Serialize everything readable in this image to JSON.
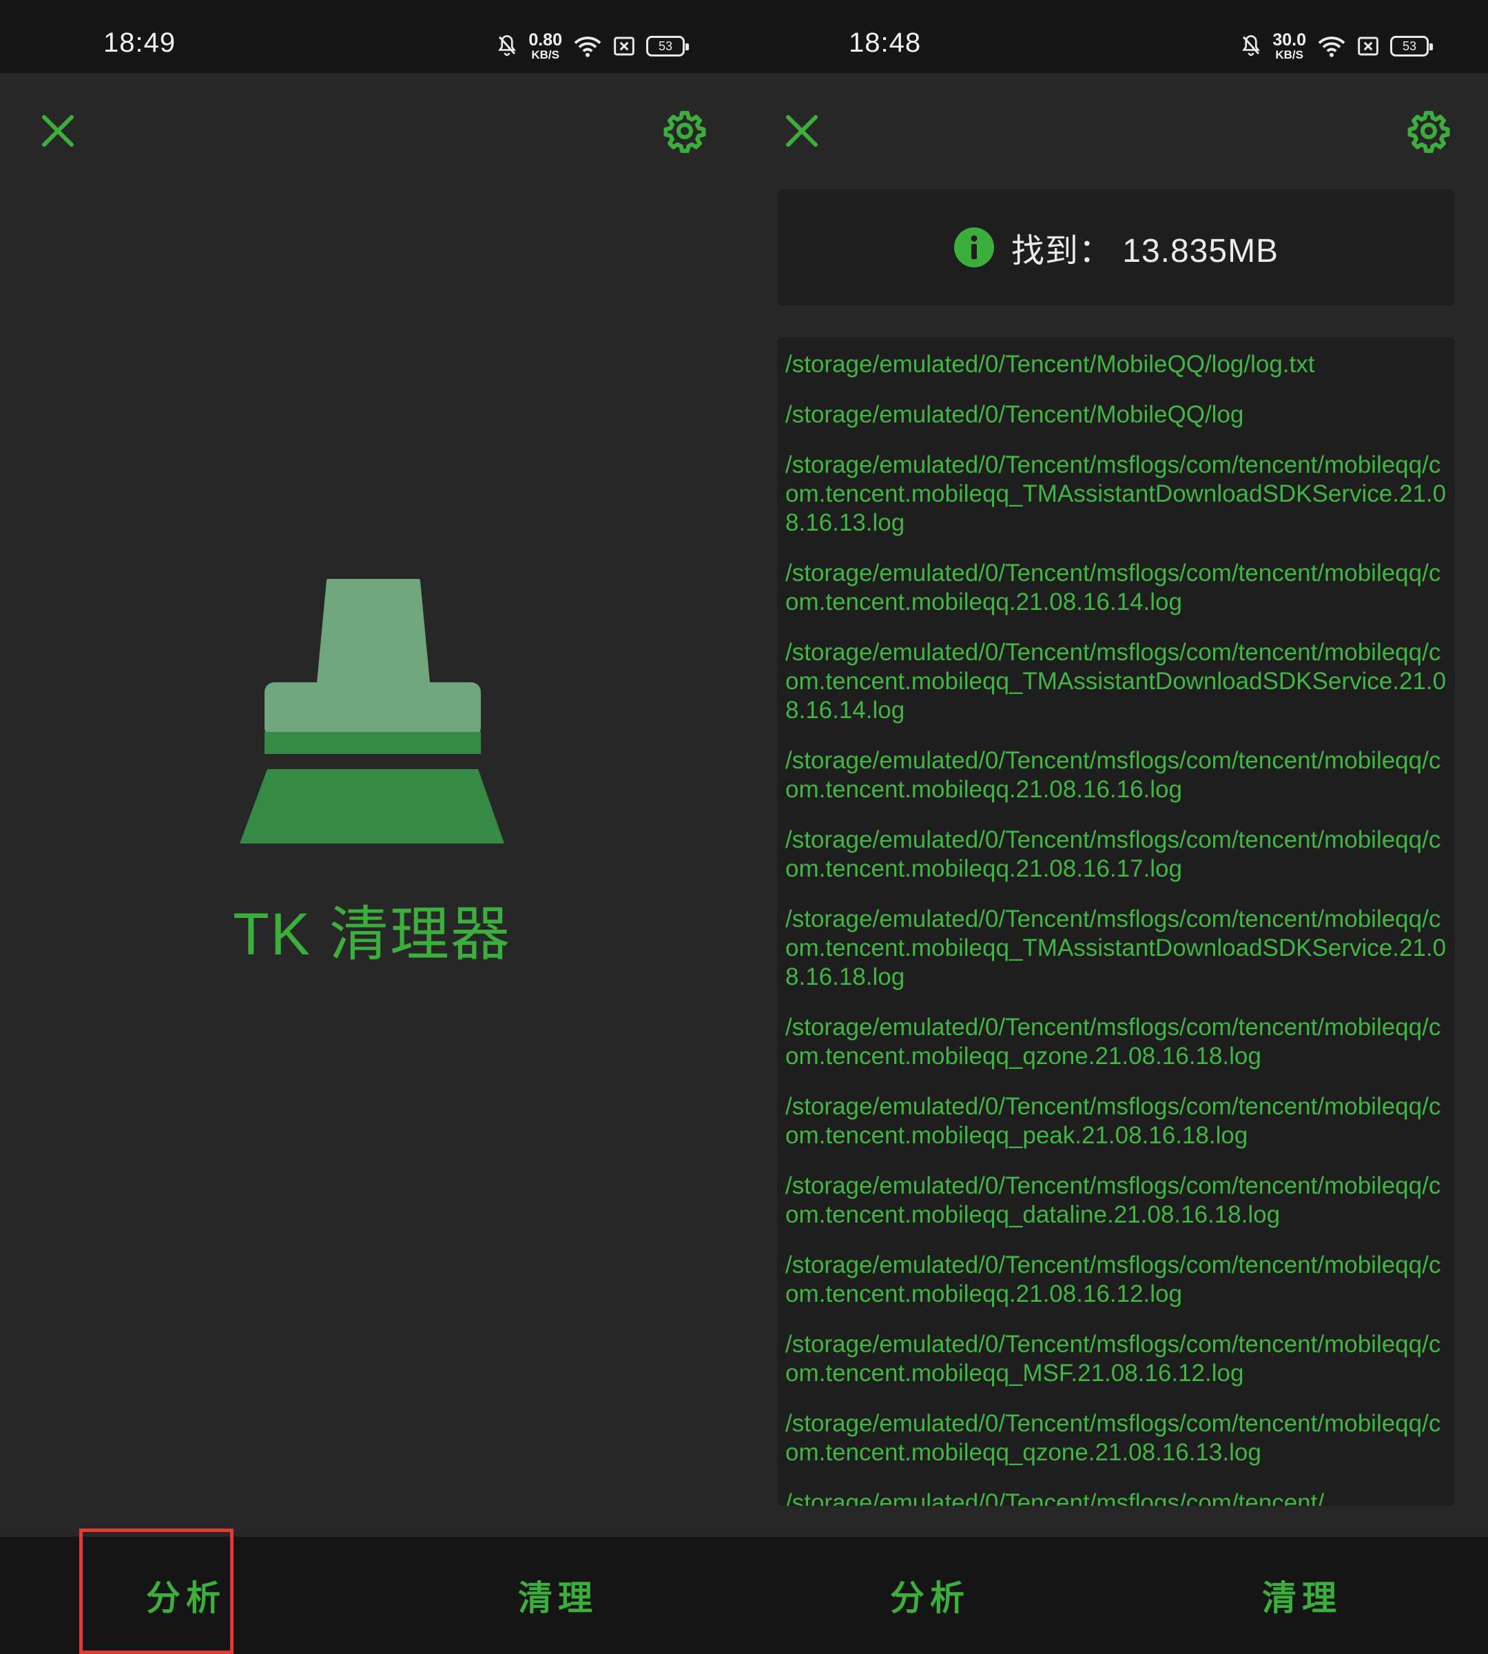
{
  "left": {
    "status": {
      "time": "18:49",
      "speed_value": "0.80",
      "speed_unit": "KB/S",
      "battery": "53"
    },
    "app_title": "TK 清理器",
    "tabs": {
      "analyze": "分析",
      "clean": "清理"
    }
  },
  "right": {
    "status": {
      "time": "18:48",
      "speed_value": "30.0",
      "speed_unit": "KB/S",
      "battery": "53"
    },
    "found_text": "找到： 13.835MB",
    "paths": [
      "/storage/emulated/0/Tencent/MobileQQ/log/log.txt",
      "/storage/emulated/0/Tencent/MobileQQ/log",
      "/storage/emulated/0/Tencent/msflogs/com/tencent/mobileqq/com.tencent.mobileqq_TMAssistantDownloadSDKService.21.08.16.13.log",
      "/storage/emulated/0/Tencent/msflogs/com/tencent/mobileqq/com.tencent.mobileqq.21.08.16.14.log",
      "/storage/emulated/0/Tencent/msflogs/com/tencent/mobileqq/com.tencent.mobileqq_TMAssistantDownloadSDKService.21.08.16.14.log",
      "/storage/emulated/0/Tencent/msflogs/com/tencent/mobileqq/com.tencent.mobileqq.21.08.16.16.log",
      "/storage/emulated/0/Tencent/msflogs/com/tencent/mobileqq/com.tencent.mobileqq.21.08.16.17.log",
      "/storage/emulated/0/Tencent/msflogs/com/tencent/mobileqq/com.tencent.mobileqq_TMAssistantDownloadSDKService.21.08.16.18.log",
      "/storage/emulated/0/Tencent/msflogs/com/tencent/mobileqq/com.tencent.mobileqq_qzone.21.08.16.18.log",
      "/storage/emulated/0/Tencent/msflogs/com/tencent/mobileqq/com.tencent.mobileqq_peak.21.08.16.18.log",
      "/storage/emulated/0/Tencent/msflogs/com/tencent/mobileqq/com.tencent.mobileqq_dataline.21.08.16.18.log",
      "/storage/emulated/0/Tencent/msflogs/com/tencent/mobileqq/com.tencent.mobileqq.21.08.16.12.log",
      "/storage/emulated/0/Tencent/msflogs/com/tencent/mobileqq/com.tencent.mobileqq_MSF.21.08.16.12.log",
      "/storage/emulated/0/Tencent/msflogs/com/tencent/mobileqq/com.tencent.mobileqq_qzone.21.08.16.13.log",
      "/storage/emulated/0/Tencent/msflogs/com/tencent/"
    ],
    "tabs": {
      "analyze": "分析",
      "clean": "清理"
    }
  },
  "icons": {
    "close": "close-icon",
    "settings": "gear-icon",
    "info": "info-icon",
    "logo": "broom-icon",
    "mute": "bell-off-icon",
    "wifi": "wifi-icon",
    "sim": "sim-off-icon",
    "battery": "battery-icon"
  },
  "colors": {
    "accent": "#3cae3c",
    "highlight": "#e53935",
    "background": "#272727",
    "card": "#1e1e1e"
  }
}
